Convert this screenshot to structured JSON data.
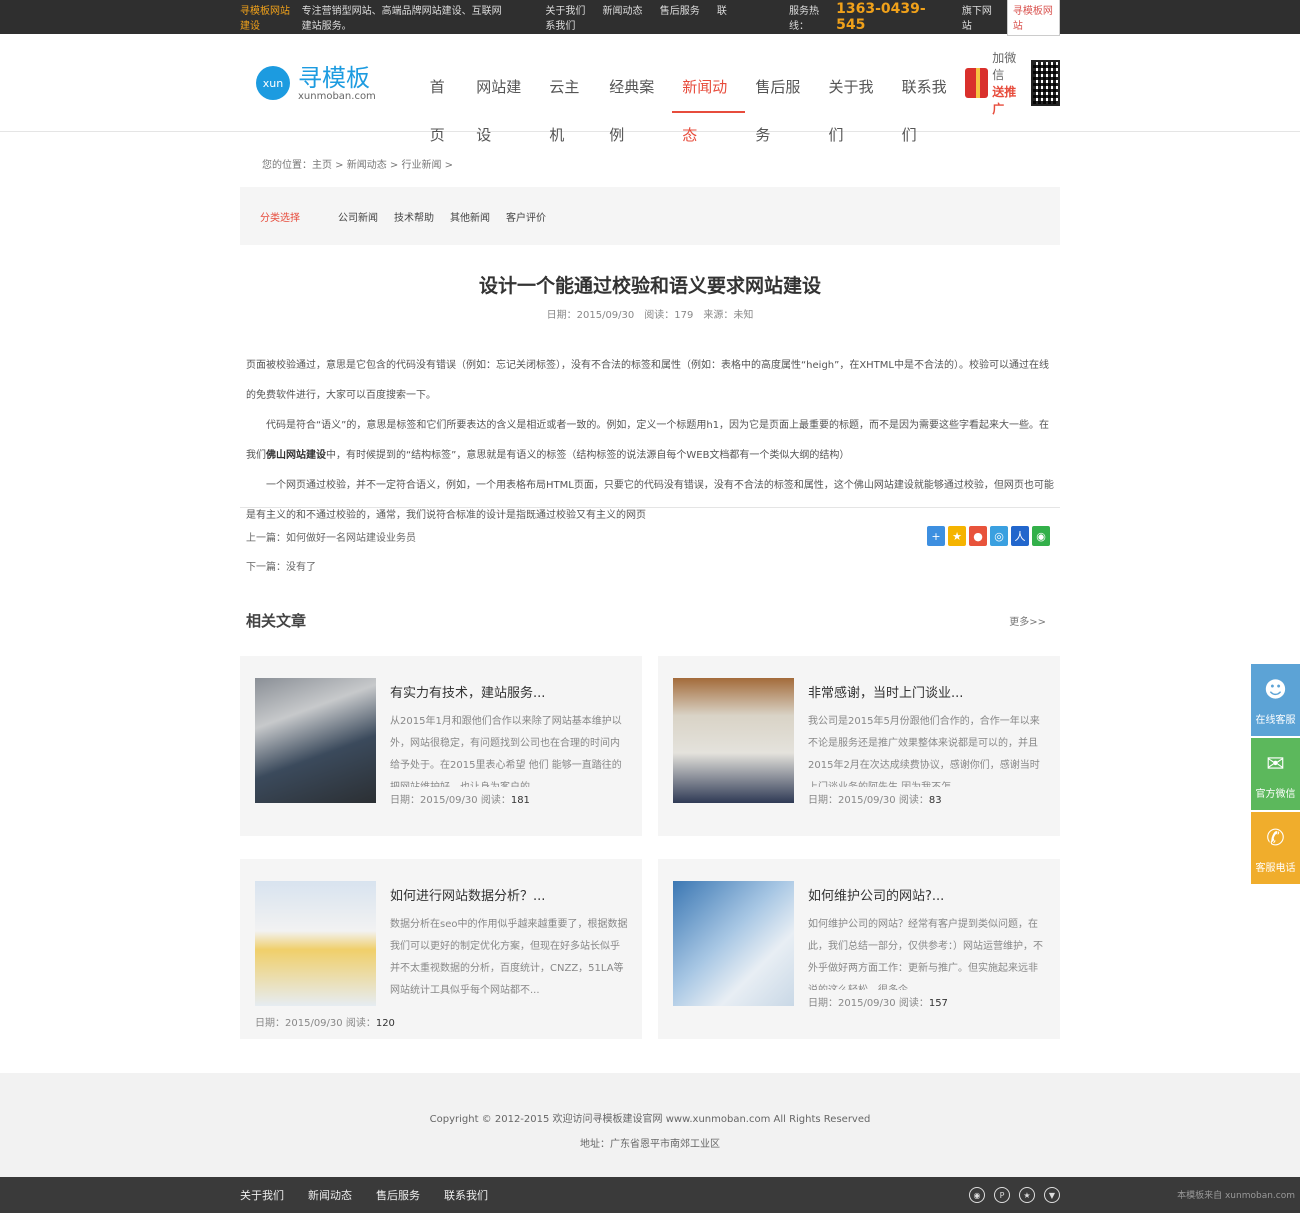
{
  "topbar": {
    "brand": "寻模板网站建设",
    "slogan": "专注营销型网站、高端品牌网站建设、互联网建站服务。",
    "links": [
      "关于我们",
      "新闻动态",
      "售后服务",
      "联系我们"
    ],
    "hotline_label": "服务热线：",
    "phone": "1363-0439-545",
    "download": "旗下网站",
    "tag": "寻模板网站"
  },
  "header": {
    "logo_circle": "xun",
    "logo_cn": "寻模板",
    "logo_en": "xunmoban.com",
    "nav": [
      "首页",
      "网站建设",
      "云主机",
      "经典案例",
      "新闻动态",
      "售后服务",
      "关于我们",
      "联系我们"
    ],
    "gift_line1": "加微信",
    "gift_line2": "送推广"
  },
  "breadcrumb": "您的位置：主页 > 新闻动态 > 行业新闻 >",
  "category": {
    "label": "分类选择",
    "items": [
      "公司新闻",
      "技术帮助",
      "其他新闻",
      "客户评价"
    ]
  },
  "article": {
    "title": "设计一个能通过校验和语义要求网站建设",
    "meta": "日期：2015/09/30　阅读：179　来源：未知",
    "p1": "页面被校验通过，意思是它包含的代码没有错误（例如：忘记关闭标签），没有不合法的标签和属性（例如：表格中的高度属性“heigh”，在XHTML中是不合法的）。校验可以通过在线的免费软件进行，大家可以百度搜索一下。",
    "p2a": "代码是符合“语义”的，意思是标签和它们所要表达的含义是相近或者一致的。例如，定义一个标题用h1，因为它是页面上最重要的标题，而不是因为需要这些字看起来大一些。在我们",
    "p2b": "佛山网站建设",
    "p2c": "中，有时候提到的“结构标签”，意思就是有语义的标签（结构标签的说法源自每个WEB文档都有一个类似大纲的结构）",
    "p3": "一个网页通过校验，并不一定符合语义，例如，一个用表格布局HTML页面，只要它的代码没有错误，没有不合法的标签和属性，这个佛山网站建设就能够通过校验，但网页也可能是有主义的和不通过校验的，通常，我们说符合标准的设计是指既通过校验又有主义的网页",
    "prev": "上一篇：如何做好一名网站建设业务员",
    "next": "下一篇：没有了"
  },
  "related": {
    "heading": "相关文章",
    "more": "更多>>",
    "cards": [
      {
        "title": "有实力有技术，建站服务...",
        "desc": "从2015年1月和跟他们合作以来除了网站基本维护以外，网站很稳定，有问题找到公司也在合理的时间内给予处于。在2015里表心希望 他们 能够一直踏往的把网站维护好，也让身为客户的...",
        "meta_prefix": "日期：2015/09/30 阅读：",
        "views": "181"
      },
      {
        "title": "非常感谢，当时上门谈业...",
        "desc": "我公司是2015年5月份跟他们合作的，合作一年以来不论是服务还是推广效果整体来说都是可以的，并且2015年2月在次达成续费协议，感谢你们，感谢当时上门谈业务的阿先生,因为我不怎...",
        "meta_prefix": "日期：2015/09/30 阅读：",
        "views": "83"
      },
      {
        "title": "如何进行网站数据分析？...",
        "desc": "数据分析在seo中的作用似乎越来越重要了，根据数据我们可以更好的制定优化方案，但现在好多站长似乎并不太重视数据的分析，百度统计，CNZZ，51LA等网站统计工具似乎每个网站都不...",
        "meta_prefix": "日期：2015/09/30 阅读：",
        "views": "120"
      },
      {
        "title": "如何维护公司的网站?...",
        "desc": "如何维护公司的网站？经常有客户提到类似问题，在此，我们总结一部分，仅供参考：）网站运营维护，不外乎做好两方面工作：更新与推广。但实施起来远非说的这么轻松，很多企...",
        "meta_prefix": "日期：2015/09/30 阅读：",
        "views": "157"
      }
    ]
  },
  "footer": {
    "copyright": "Copyright © 2012-2015 欢迎访问寻模板建设官网 www.xunmoban.com All Rights Reserved",
    "address": "地址：广东省恩平市南郊工业区"
  },
  "bottombar": {
    "links": [
      "关于我们",
      "新闻动态",
      "售后服务",
      "联系我们"
    ],
    "credit": "本模板来自 xunmoban.com"
  },
  "side": {
    "items": [
      {
        "label": "在线客服",
        "color": "#5ca3d6",
        "icon": "qq-icon"
      },
      {
        "label": "官方微信",
        "color": "#5cb85c",
        "icon": "wechat-icon"
      },
      {
        "label": "客服电话",
        "color": "#f0ad2c",
        "icon": "phone-icon"
      }
    ]
  },
  "colors": {
    "accent": "#e74c3c",
    "brand": "#1c9be0",
    "hotline": "#f0a11a"
  }
}
